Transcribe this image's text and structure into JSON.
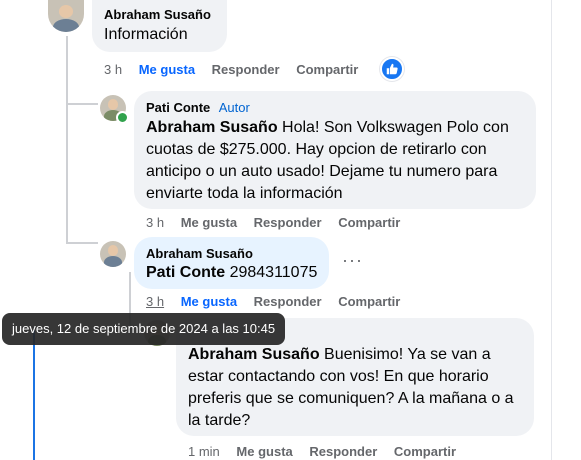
{
  "comments": [
    {
      "author": "Abraham Susaño",
      "text": "Información",
      "time": "3 h",
      "like": "Me gusta",
      "reply": "Responder",
      "share": "Compartir"
    },
    {
      "author": "Pati Conte",
      "badge": "Autor",
      "mention": "Abraham Susaño",
      "lines": [
        " Hola! Son Volkswagen Polo con",
        "cuotas de $275.000. Hay opcion de retirarlo con",
        "anticipo o un auto usado! Dejame tu numero para",
        "enviarte toda la información"
      ],
      "time": "3 h",
      "like": "Me gusta",
      "reply": "Responder",
      "share": "Compartir"
    },
    {
      "author": "Abraham Susaño",
      "mention": "Pati Conte",
      "text": " 2984311075",
      "time": "3 h",
      "like": "Me gusta",
      "reply": "Responder",
      "share": "Compartir"
    },
    {
      "mention": "Abraham Susaño",
      "lines": [
        " Buenisimo! Ya se van a",
        "estar contactando con vos! En que horario",
        "preferis que se comuniquen? A la mañana o a",
        "la tarde?"
      ],
      "time": "1 min",
      "like": "Me gusta",
      "reply": "Responder",
      "share": "Compartir"
    }
  ],
  "tooltip": "jueves, 12 de septiembre de 2024 a las 10:45",
  "more": "···",
  "colors": {
    "like_blue": "#0866ff",
    "bubble": "#f0f2f5",
    "highlight": "#e7f3ff"
  }
}
